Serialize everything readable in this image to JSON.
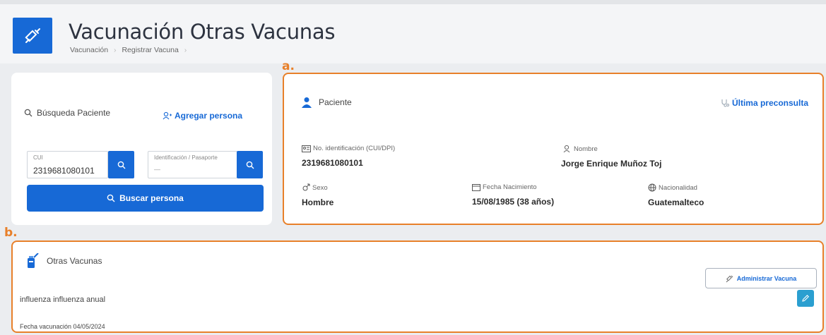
{
  "header": {
    "title": "Vacunación Otras Vacunas",
    "breadcrumb": [
      "Vacunación",
      "Registrar Vacuna"
    ],
    "app_icon": "syringe-icon"
  },
  "markers": {
    "a": "a.",
    "b": "b."
  },
  "search": {
    "title": "Búsqueda Paciente",
    "add_person": "Agregar persona",
    "cui_label": "CUI",
    "cui_value": "2319681080101",
    "id_label": "Identificación / Pasaporte",
    "id_value": "—",
    "search_button": "Buscar persona"
  },
  "patient": {
    "title": "Paciente",
    "last_preconsult": "Última preconsulta",
    "fields": {
      "id_label": "No. identificación (CUI/DPI)",
      "id_value": "2319681080101",
      "name_label": "Nombre",
      "name_value": "Jorge Enrique Muñoz Toj",
      "sex_label": "Sexo",
      "sex_value": "Hombre",
      "birth_label": "Fecha Nacimiento",
      "birth_value": "15/08/1985 (38 años)",
      "nationality_label": "Nacionalidad",
      "nationality_value": "Guatemalteco"
    }
  },
  "vaccines": {
    "title": "Otras Vacunas",
    "admin_button": "Administrar Vacuna",
    "item_name": "influenza influenza anual",
    "item_date": "Fecha vacunación 04/05/2024"
  },
  "colors": {
    "primary": "#1769d6",
    "highlight": "#e8802a",
    "edit": "#2b9fd0"
  }
}
